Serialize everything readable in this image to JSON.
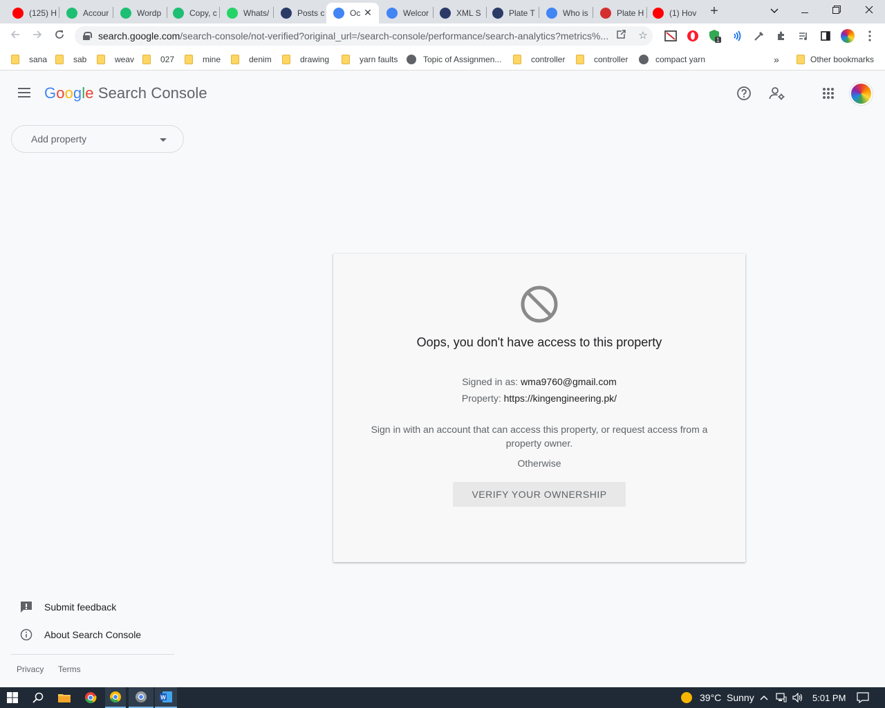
{
  "browser": {
    "tabs": [
      {
        "title": "(125) H",
        "icon": "youtube-icon",
        "color": "#ff0000"
      },
      {
        "title": "Accour",
        "icon": "fiverr-icon",
        "color": "#1dbf73"
      },
      {
        "title": "Wordp",
        "icon": "fiverr-icon",
        "color": "#1dbf73"
      },
      {
        "title": "Copy, c",
        "icon": "fiverr-icon",
        "color": "#1dbf73"
      },
      {
        "title": "Whats/",
        "icon": "whatsapp-icon",
        "color": "#25d366"
      },
      {
        "title": "Posts c",
        "icon": "k-icon",
        "color": "#2b3a67"
      },
      {
        "title": "Oc",
        "icon": "search-console-icon",
        "color": "#4285f4",
        "active": true
      },
      {
        "title": "Welcor",
        "icon": "search-console-icon",
        "color": "#4285f4"
      },
      {
        "title": "XML S",
        "icon": "k-icon",
        "color": "#2b3a67"
      },
      {
        "title": "Plate T",
        "icon": "k-icon",
        "color": "#2b3a67"
      },
      {
        "title": "Who is",
        "icon": "google-icon",
        "color": "#4285f4"
      },
      {
        "title": "Plate H",
        "icon": "plate-icon",
        "color": "#d32f2f"
      },
      {
        "title": "(1) Hov",
        "icon": "youtube-icon",
        "color": "#ff0000"
      }
    ],
    "url_host": "search.google.com",
    "url_rest": "/search-console/not-verified?original_url=/search-console/performance/search-analytics?metrics%...",
    "extension_badge": "1",
    "bookmarks": [
      {
        "label": "sana",
        "type": "folder"
      },
      {
        "label": "sab",
        "type": "folder"
      },
      {
        "label": "weav",
        "type": "folder"
      },
      {
        "label": "027",
        "type": "folder"
      },
      {
        "label": "mine",
        "type": "folder"
      },
      {
        "label": "denim",
        "type": "folder"
      },
      {
        "label": "drawing",
        "type": "folder"
      },
      {
        "label": "yarn faults",
        "type": "folder"
      },
      {
        "label": "Topic of Assignmen...",
        "type": "page"
      },
      {
        "label": "controller",
        "type": "folder"
      },
      {
        "label": "controller",
        "type": "folder"
      },
      {
        "label": "compact yarn",
        "type": "page"
      }
    ],
    "bookmarks_overflow": "»",
    "other_bookmarks": "Other bookmarks"
  },
  "app": {
    "logo_letters": [
      "G",
      "o",
      "o",
      "g",
      "l",
      "e"
    ],
    "product_name": "Search Console",
    "property_placeholder": "Add property"
  },
  "error": {
    "title": "Oops, you don't have access to this property",
    "signed_in_label": "Signed in as:",
    "signed_in_value": "wma9760@gmail.com",
    "property_label": "Property:",
    "property_value": "https://kingengineering.pk/",
    "description": "Sign in with an account that can access this property, or request access from a property owner.",
    "otherwise": "Otherwise",
    "verify_button": "VERIFY YOUR OWNERSHIP"
  },
  "sidebar": {
    "submit_feedback": "Submit feedback",
    "about": "About Search Console",
    "privacy": "Privacy",
    "terms": "Terms"
  },
  "taskbar": {
    "weather_temp": "39°C",
    "weather_text": "Sunny",
    "time": "5:01 PM"
  },
  "colors": {
    "accent_blue": "#4285f4",
    "page_background": "#f8f9fa",
    "taskbar": "#1f2a36"
  }
}
